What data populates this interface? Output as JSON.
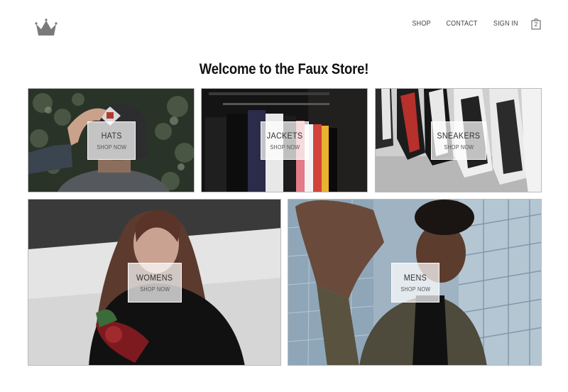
{
  "nav": {
    "logo_icon": "crown-icon",
    "links": [
      "SHOP",
      "CONTACT",
      "SIGN IN"
    ],
    "cart_icon": "shopping-bag-icon",
    "cart_count": "2"
  },
  "page": {
    "title": "Welcome to the Faux Store!"
  },
  "categories": [
    {
      "title": "HATS",
      "cta": "SHOP NOW"
    },
    {
      "title": "JACKETS",
      "cta": "SHOP NOW"
    },
    {
      "title": "SNEAKERS",
      "cta": "SHOP NOW"
    },
    {
      "title": "WOMENS",
      "cta": "SHOP NOW"
    },
    {
      "title": "MENS",
      "cta": "SHOP NOW"
    }
  ],
  "colors": {
    "logo": "#7a7a7a",
    "text": "#333333"
  }
}
